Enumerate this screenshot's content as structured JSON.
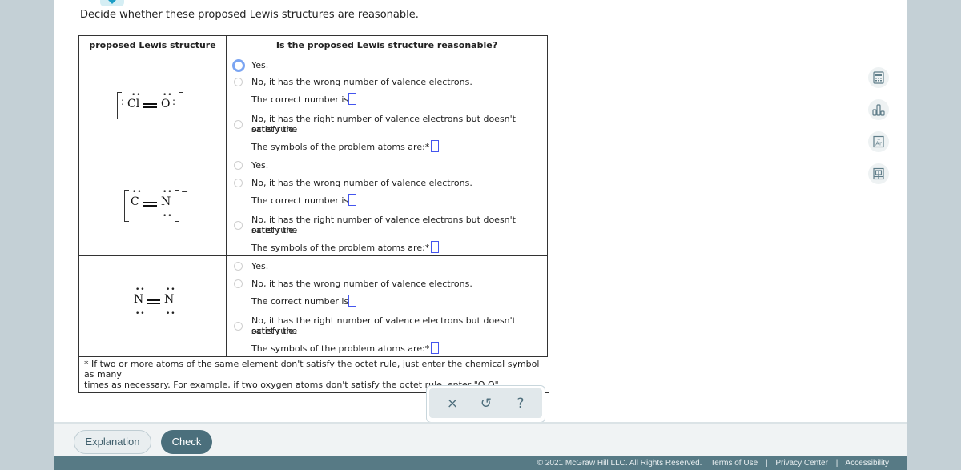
{
  "prompt": "Decide whether these proposed Lewis structures are reasonable.",
  "table": {
    "headers": [
      "proposed Lewis structure",
      "Is the proposed Lewis structure reasonable?"
    ],
    "rows": [
      {
        "structure": {
          "atom1": "Cl",
          "bond": "double",
          "atom2": "O",
          "charge": "−",
          "bracketed": true
        },
        "options": {
          "yes": "Yes.",
          "wrong_valence": "No, it has the wrong number of valence electrons.",
          "correct_number_label": "The correct number is:",
          "correct_number_value": "",
          "octet_line1": "No, it has the right number of valence electrons but doesn't satisfy the",
          "octet_line2": "octet rule.",
          "problem_atoms_label": "The symbols of the problem atoms are:*",
          "problem_atoms_value": ""
        },
        "focused_option": "yes"
      },
      {
        "structure": {
          "atom1": "C",
          "bond": "double",
          "atom2": "N",
          "charge": "−",
          "bracketed": true
        },
        "options": {
          "yes": "Yes.",
          "wrong_valence": "No, it has the wrong number of valence electrons.",
          "correct_number_label": "The correct number is:",
          "correct_number_value": "",
          "octet_line1": "No, it has the right number of valence electrons but doesn't satisfy the",
          "octet_line2": "octet rule.",
          "problem_atoms_label": "The symbols of the problem atoms are:*",
          "problem_atoms_value": ""
        }
      },
      {
        "structure": {
          "atom1": "N",
          "bond": "double",
          "atom2": "N",
          "charge": "",
          "bracketed": false
        },
        "options": {
          "yes": "Yes.",
          "wrong_valence": "No, it has the wrong number of valence electrons.",
          "correct_number_label": "The correct number is:",
          "correct_number_value": "",
          "octet_line1": "No, it has the right number of valence electrons but doesn't satisfy the",
          "octet_line2": "octet rule.",
          "problem_atoms_label": "The symbols of the problem atoms are:*",
          "problem_atoms_value": ""
        }
      }
    ],
    "footnote_line1": "* If two or more atoms of the same element don't satisfy the octet rule, just enter the chemical symbol as many",
    "footnote_line2": "times as necessary. For example, if two oxygen atoms don't satisfy the octet rule, enter \"O,O\"."
  },
  "tools": {
    "clear": "×",
    "undo": "↺",
    "help": "?"
  },
  "side_tools": [
    "calculator-icon",
    "bar-chart-icon",
    "periodic-table-icon",
    "data-table-icon"
  ],
  "buttons": {
    "explanation": "Explanation",
    "check": "Check"
  },
  "footer": {
    "copyright": "© 2021 McGraw Hill LLC. All Rights Reserved.",
    "links": [
      "Terms of Use",
      "Privacy Center",
      "Accessibility"
    ]
  },
  "colors": {
    "accent": "#4b6f7c",
    "footer": "#577a85",
    "input_border": "#4455ee",
    "focus_ring": "#7ba5f2"
  }
}
